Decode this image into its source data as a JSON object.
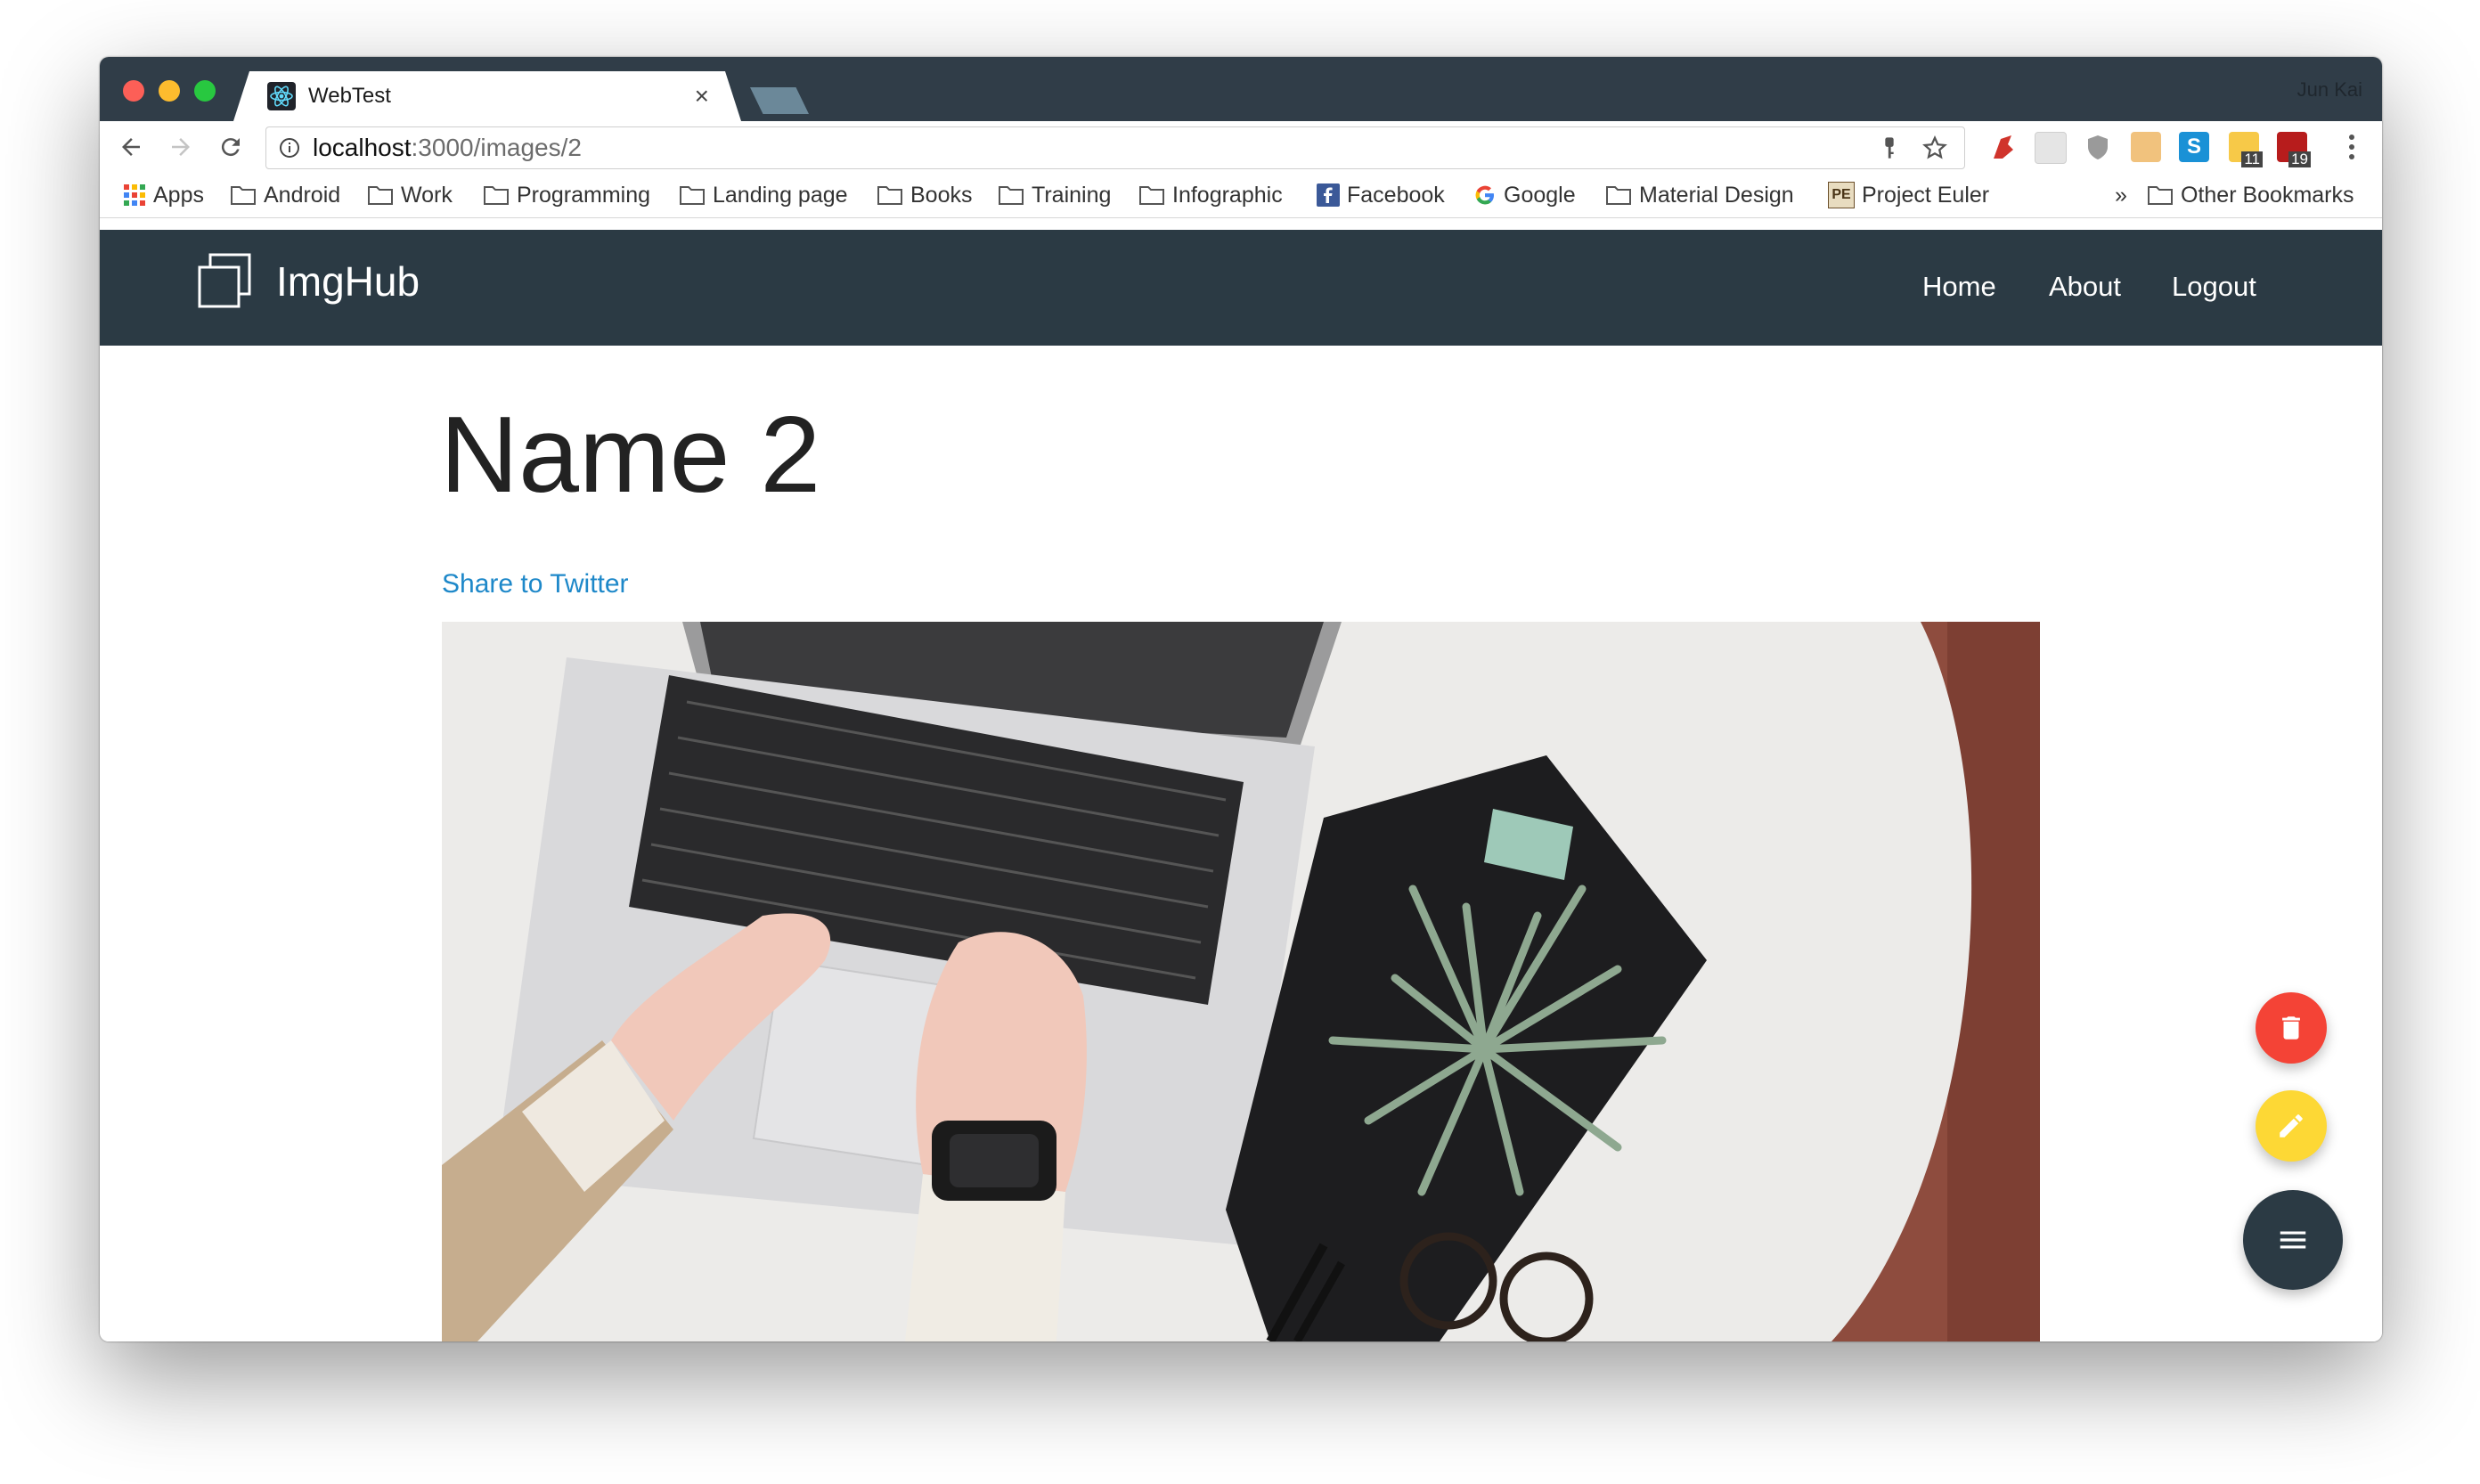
{
  "browser": {
    "tab": {
      "title": "WebTest",
      "close_glyph": "×"
    },
    "profile_name": "Jun Kai",
    "address": {
      "host": "localhost",
      "rest": ":3000/images/2"
    },
    "extension_badges": [
      "11",
      "19"
    ],
    "bookmarks": {
      "apps": "Apps",
      "items": [
        "Android",
        "Work",
        "Programming",
        "Landing page",
        "Books",
        "Training",
        "Infographic",
        "Facebook",
        "Google",
        "Material Design",
        "Project Euler"
      ],
      "overflow_glyph": "»",
      "other": "Other Bookmarks"
    }
  },
  "site": {
    "brand": "ImgHub",
    "nav": {
      "home": "Home",
      "about": "About",
      "logout": "Logout"
    },
    "accent_color": "#2b3a44"
  },
  "page": {
    "title": "Name 2",
    "share_link": "Share to Twitter"
  },
  "fabs": {
    "delete_color": "#f44336",
    "edit_color": "#fdd835",
    "menu_color": "#2b3a44"
  }
}
